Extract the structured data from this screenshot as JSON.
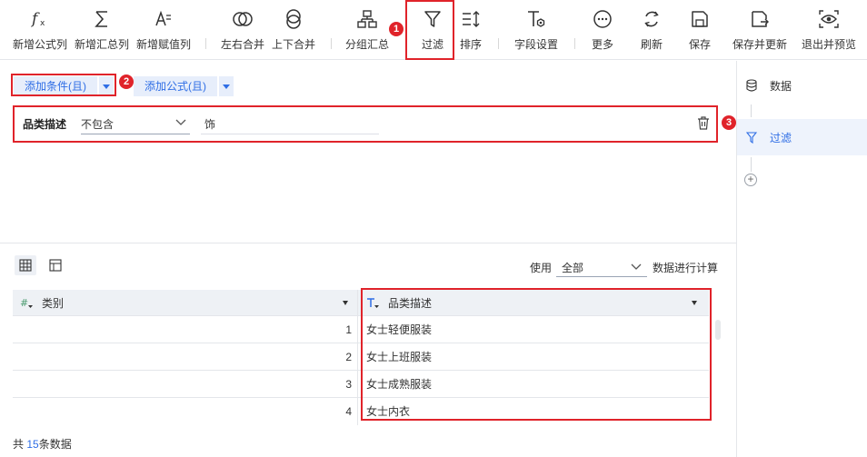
{
  "toolbar": {
    "items": [
      {
        "label": "新增公式列",
        "icon": "formula-icon"
      },
      {
        "label": "新增汇总列",
        "icon": "sum-icon"
      },
      {
        "label": "新增赋值列",
        "icon": "assign-icon"
      },
      {
        "label": "左右合并",
        "icon": "merge-lr-icon"
      },
      {
        "label": "上下合并",
        "icon": "merge-ud-icon"
      },
      {
        "label": "分组汇总",
        "icon": "group-icon"
      },
      {
        "label": "过滤",
        "icon": "filter-icon"
      },
      {
        "label": "排序",
        "icon": "sort-icon"
      },
      {
        "label": "字段设置",
        "icon": "field-settings-icon"
      },
      {
        "label": "更多",
        "icon": "more-icon"
      },
      {
        "label": "刷新",
        "icon": "refresh-icon"
      },
      {
        "label": "保存",
        "icon": "save-icon"
      },
      {
        "label": "保存并更新",
        "icon": "save-update-icon"
      },
      {
        "label": "退出并预览",
        "icon": "exit-preview-icon"
      }
    ]
  },
  "annotations": {
    "badge1": "1",
    "badge2": "2",
    "badge3": "3"
  },
  "condition_bar": {
    "add_condition": "添加条件(且)",
    "add_formula": "添加公式(且)"
  },
  "condition": {
    "field": "品类描述",
    "operator": "不包含",
    "value": "饰"
  },
  "right_panel": {
    "steps": [
      {
        "label": "数据",
        "icon": "database-icon",
        "active": false
      },
      {
        "label": "过滤",
        "icon": "filter-icon",
        "active": true
      }
    ],
    "add": "+"
  },
  "preview": {
    "use_label": "使用",
    "scope_value": "全部",
    "calc_label": "数据进行计算",
    "columns": [
      {
        "name": "类别",
        "type_icon": "#",
        "type": "number"
      },
      {
        "name": "品类描述",
        "type_icon": "T",
        "type": "text"
      }
    ],
    "rows": [
      {
        "num": "1",
        "text": "女士轻便服装"
      },
      {
        "num": "2",
        "text": "女士上班服装"
      },
      {
        "num": "3",
        "text": "女士成熟服装"
      },
      {
        "num": "4",
        "text": "女士内衣"
      }
    ],
    "footer_prefix": "共",
    "footer_count": "15",
    "footer_suffix": "条数据"
  },
  "colors": {
    "accent": "#2f6ee5",
    "highlight": "#e0232a",
    "header_bg": "#eef1f5"
  }
}
